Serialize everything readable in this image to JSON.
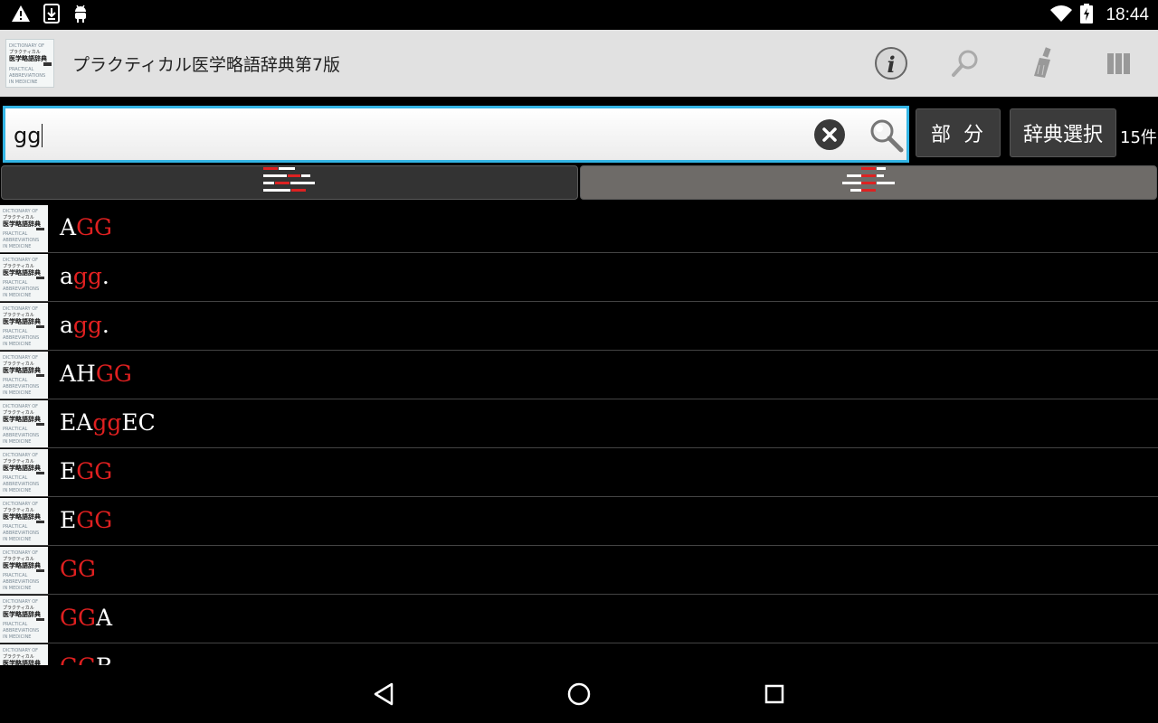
{
  "status_bar": {
    "time": "18:44",
    "icons": [
      "warning-icon",
      "download-icon",
      "android-icon",
      "wifi-icon",
      "battery-charging-icon"
    ]
  },
  "action_bar": {
    "title": "プラクティカル医学略語辞典第7版",
    "logo_text": [
      "DICTIONARY OF",
      "プラクティカル",
      "医学略語辞典",
      "第7版",
      "PRACTICAL",
      "ABBREVIATIONS",
      "IN MEDICINE"
    ],
    "icons": [
      "info-icon",
      "search-icon",
      "brush-icon",
      "bookshelf-icon"
    ]
  },
  "search": {
    "query": "gg",
    "clear_icon": "clear-icon",
    "search_icon": "magnifier-icon",
    "mode_label": "部分",
    "dict_select_label": "辞典選択",
    "result_count": "15件"
  },
  "tabs": [
    {
      "icon": "list-left-icon",
      "selected": true
    },
    {
      "icon": "list-center-icon",
      "selected": false
    }
  ],
  "colors": {
    "highlight": "#e02020",
    "focus_border": "#33b5e5",
    "action_bar_bg": "#e1e1e1"
  },
  "results": [
    {
      "pre": "A",
      "match": "GG",
      "post": ""
    },
    {
      "pre": "a",
      "match": "gg",
      "post": "."
    },
    {
      "pre": "a",
      "match": "gg",
      "post": "."
    },
    {
      "pre": "AH",
      "match": "GG",
      "post": ""
    },
    {
      "pre": "EA",
      "match": "gg",
      "post": "EC"
    },
    {
      "pre": "E",
      "match": "GG",
      "post": ""
    },
    {
      "pre": "E",
      "match": "GG",
      "post": ""
    },
    {
      "pre": "",
      "match": "GG",
      "post": ""
    },
    {
      "pre": "",
      "match": "GG",
      "post": "A"
    },
    {
      "pre": "",
      "match": "GG",
      "post": "B"
    }
  ]
}
